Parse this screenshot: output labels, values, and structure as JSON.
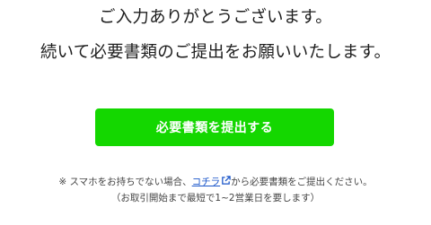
{
  "message": {
    "line1": "ご入力ありがとうございます。",
    "line2": "続いて必要書類のご提出をお願いいたします。"
  },
  "submit_button": {
    "label": "必要書類を提出する",
    "color": "#14d700"
  },
  "note": {
    "prefix": "※ スマホをお持ちでない場合、",
    "link_text": "コチラ",
    "link_icon": "external-link-icon",
    "suffix": "から必要書類をご提出ください。",
    "line2": "（お取引開始まで最短で1~2営業日を要します）",
    "link_color": "#1a55c9"
  }
}
